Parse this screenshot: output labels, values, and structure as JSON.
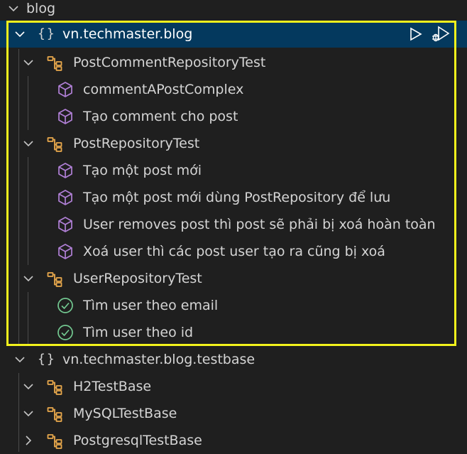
{
  "root": {
    "label": "blog"
  },
  "packages": [
    {
      "label": "vn.techmaster.blog",
      "selected": true,
      "actions": [
        {
          "name": "run-test-icon",
          "icon": "play-outline"
        },
        {
          "name": "debug-test-icon",
          "icon": "bug-play"
        }
      ],
      "classes": [
        {
          "label": "PostCommentRepositoryTest",
          "tests": [
            {
              "label": "commentAPostComplex",
              "status": "not-run"
            },
            {
              "label": "Tạo comment cho post",
              "status": "not-run"
            }
          ]
        },
        {
          "label": "PostRepositoryTest",
          "tests": [
            {
              "label": "Tạo một post mới",
              "status": "not-run"
            },
            {
              "label": "Tạo một post mới dùng PostRepository để lưu",
              "status": "not-run"
            },
            {
              "label": "User removes post thì post sẽ phải bị xoá hoàn toàn",
              "status": "not-run"
            },
            {
              "label": "Xoá user thì các post user tạo ra cũng bị xoá",
              "status": "not-run"
            }
          ]
        },
        {
          "label": "UserRepositoryTest",
          "tests": [
            {
              "label": "Tìm user theo email",
              "status": "passed"
            },
            {
              "label": "Tìm user theo id",
              "status": "passed"
            }
          ]
        }
      ]
    },
    {
      "label": "vn.techmaster.blog.testbase",
      "selected": false,
      "classes": [
        {
          "label": "H2TestBase",
          "expanded": true
        },
        {
          "label": "MySQLTestBase",
          "expanded": true
        },
        {
          "label": "PostgresqlTestBase",
          "expanded": false
        }
      ]
    }
  ],
  "colors": {
    "class_icon": "#e8a84c",
    "method_icon": "#b180d7",
    "passed_icon": "#73c991",
    "selection": "#04395e",
    "highlight_box": "#f2f21c"
  }
}
